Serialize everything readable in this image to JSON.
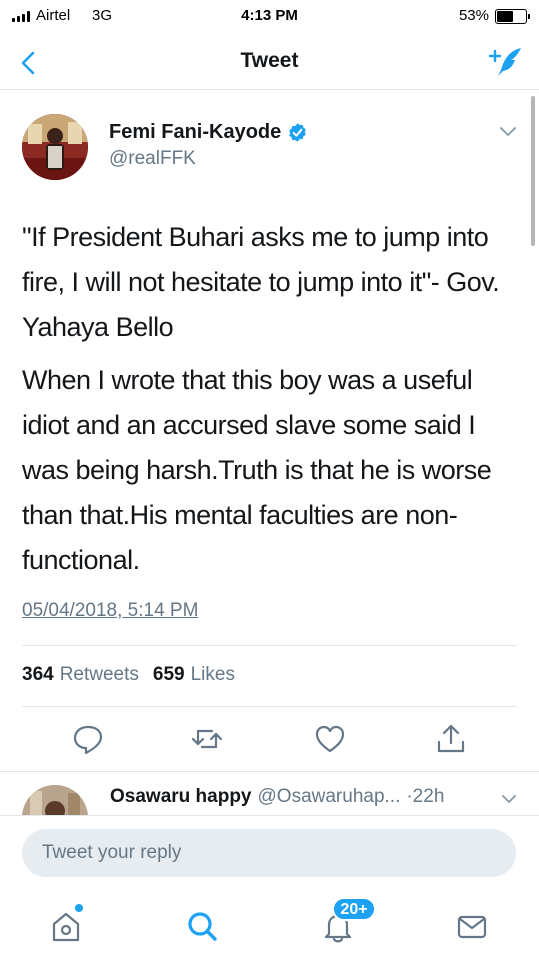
{
  "status_bar": {
    "carrier": "Airtel",
    "network": "3G",
    "time": "4:13 PM",
    "battery_percent": "53%",
    "battery_level": 0.53
  },
  "nav": {
    "title": "Tweet",
    "back_icon": "chevron-left-icon",
    "compose_icon": "compose-feather-icon"
  },
  "tweet": {
    "author": {
      "name": "Femi Fani-Kayode",
      "handle": "@realFFK",
      "verified": true
    },
    "paragraphs": [
      "\"If President Buhari asks me to jump into fire, I will not hesitate to jump into it\"- Gov. Yahaya Bello",
      "When I wrote that this boy was a useful idiot and an accursed slave some said I was being harsh.Truth is that he is worse than that.His mental faculties are non-functional."
    ],
    "timestamp": "05/04/2018, 5:14 PM",
    "retweets": {
      "count": "364",
      "label": "Retweets"
    },
    "likes": {
      "count": "659",
      "label": "Likes"
    },
    "actions": [
      "reply-icon",
      "retweet-icon",
      "like-icon",
      "share-icon"
    ]
  },
  "reply": {
    "name": "Osawaru happy",
    "handle": "@Osawaruhap...",
    "time": "·22h"
  },
  "composer": {
    "placeholder": "Tweet your reply"
  },
  "tab_bar": {
    "items": [
      "home-icon",
      "search-icon",
      "notifications-icon",
      "messages-icon"
    ],
    "notifications_badge": "20+"
  },
  "colors": {
    "accent": "#1da1f2",
    "secondary_text": "#657786",
    "primary_text": "#14171a",
    "divider": "#e1e8ed"
  }
}
